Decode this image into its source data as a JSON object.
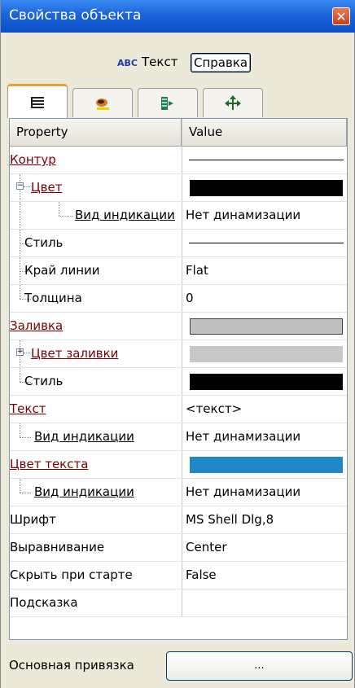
{
  "window": {
    "title": "Свойства объекта",
    "close": "✕"
  },
  "header": {
    "abc": "ABC",
    "object_name": "Текст",
    "help_label": "Справка"
  },
  "tabs": [
    {
      "name": "properties",
      "active": true
    },
    {
      "name": "brush",
      "active": false
    },
    {
      "name": "events",
      "active": false
    },
    {
      "name": "move",
      "active": false
    }
  ],
  "grid": {
    "col_property": "Property",
    "col_value": "Value",
    "rows": [
      {
        "label": "Контур",
        "value": "",
        "value_type": "line"
      },
      {
        "label": "Цвет",
        "value": "",
        "value_type": "swatch",
        "color": "#000000"
      },
      {
        "label": "Вид индикации",
        "value": "Нет динамизации",
        "value_type": "text"
      },
      {
        "label": "Стиль",
        "value": "",
        "value_type": "line"
      },
      {
        "label": "Край линии",
        "value": "Flat",
        "value_type": "text"
      },
      {
        "label": "Толщина",
        "value": "0",
        "value_type": "text"
      },
      {
        "label": "Заливка",
        "value": "",
        "value_type": "swatch",
        "color": "#c0c0c0"
      },
      {
        "label": "Цвет заливки",
        "value": "",
        "value_type": "swatch",
        "color": "#c8c8c8"
      },
      {
        "label": "Стиль",
        "value": "",
        "value_type": "swatch",
        "color": "#000000"
      },
      {
        "label": "Текст",
        "value": "<текст>",
        "value_type": "text"
      },
      {
        "label": "Вид индикации",
        "value": "Нет динамизации",
        "value_type": "text"
      },
      {
        "label": "Цвет текста",
        "value": "",
        "value_type": "swatch",
        "color": "#1e87c8"
      },
      {
        "label": "Вид индикации",
        "value": "Нет динамизации",
        "value_type": "text"
      },
      {
        "label": "Шрифт",
        "value": "MS Shell Dlg,8",
        "value_type": "text"
      },
      {
        "label": "Выравнивание",
        "value": "Center",
        "value_type": "text"
      },
      {
        "label": "Скрыть при старте",
        "value": "False",
        "value_type": "text"
      },
      {
        "label": "Подсказка",
        "value": "",
        "value_type": "text"
      }
    ]
  },
  "bottom": {
    "label": "Основная привязка",
    "button": "..."
  },
  "colors": {
    "title_bar": "#0a4fc9",
    "link_red": "#7a0000",
    "tab_highlight": "#f0a032"
  }
}
